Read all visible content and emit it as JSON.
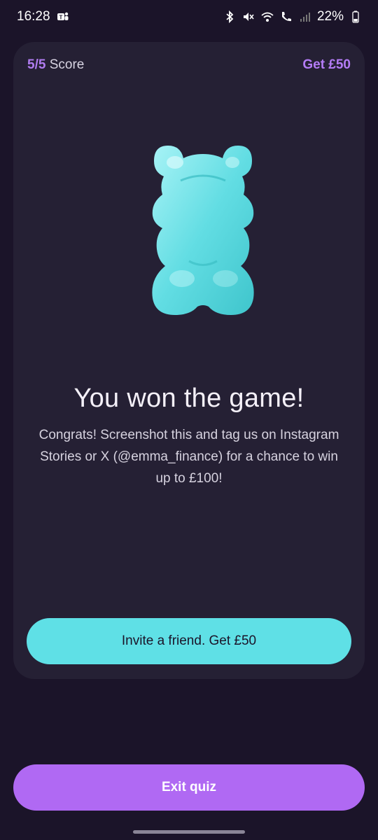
{
  "status_bar": {
    "time": "16:28",
    "battery": "22%",
    "icons": [
      "teams-icon",
      "bluetooth-icon",
      "mute-icon",
      "wifi-icon",
      "wifi-call-icon",
      "signal-icon",
      "battery-icon"
    ]
  },
  "card": {
    "score_value": "5/5",
    "score_label": "Score",
    "reward_link": "Get £50",
    "illustration": "gummy-bear-icon",
    "headline": "You won the game!",
    "subtext": "Congrats! Screenshot this and tag us on Instagram Stories or X (@emma_finance) for a chance to win up to £100!",
    "invite_button": "Invite a friend. Get £50"
  },
  "footer": {
    "exit_button": "Exit quiz"
  },
  "colors": {
    "background": "#1b1429",
    "card": "#252034",
    "accent_purple": "#b069f3",
    "accent_teal": "#5fe0e6"
  }
}
